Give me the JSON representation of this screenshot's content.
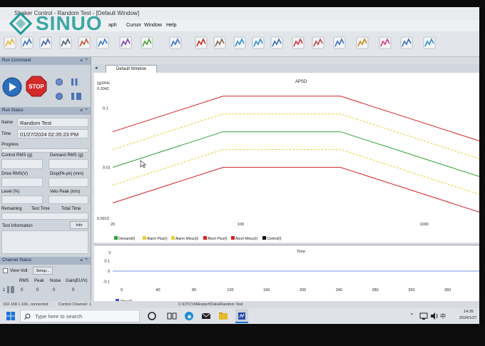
{
  "logo": {
    "text": "SINUO"
  },
  "window": {
    "title": "Shaker Control - Random Test - [Default Window]"
  },
  "menu": [
    {
      "label": "aph",
      "x": 152
    },
    {
      "label": "Cursor",
      "x": 177
    },
    {
      "label": "Window",
      "x": 202
    },
    {
      "label": "Help",
      "x": 233
    }
  ],
  "run_command": {
    "title": "Run Command",
    "stop_label": "STOP"
  },
  "run_status": {
    "title": "Run Status",
    "name_label": "Name",
    "name_value": "Random Test",
    "time_label": "Time",
    "time_value": "01/27/2024 02:35:23 PM",
    "progress_label": "Progress",
    "control_rms_label": "Control RMS (g)",
    "demand_rms_label": "Demand RMS (g)",
    "drive_rms_label": "Drive RMS(V)",
    "disp_label": "Disp(Pk-pk) (mm)",
    "level_label": "Level (%)",
    "velo_label": "Velo Peak (m/s)",
    "remaining_label": "Remaining",
    "test_time_label": "Test Time",
    "total_time_label": "Total Time",
    "test_info_label": "Test Information",
    "info_btn": "Info"
  },
  "channel_status": {
    "title": "Channel Status",
    "view_volt": "View Volt",
    "setup_btn": "Setup...",
    "columns": [
      "RMS",
      "Peak",
      "Noise",
      "Gain(EU/V)"
    ],
    "row": {
      "channel": "1",
      "values": [
        "0",
        "0",
        "0",
        "0"
      ]
    }
  },
  "tab": {
    "label": "Default Window"
  },
  "apsd": {
    "title": "APSD",
    "ylabel": "(g)2/Hz",
    "ymax_label": "0.2042",
    "ymin_label": "0.0013",
    "yticks": [
      "0.1",
      "0.01"
    ],
    "xticks": [
      "20",
      "100",
      "1000"
    ],
    "legend": [
      {
        "label": "Demand(l)",
        "color": "#2ea02e"
      },
      {
        "label": "Alarm Plus(l)",
        "color": "#e6cf2e"
      },
      {
        "label": "Alarm Minus(l)",
        "color": "#e6cf2e"
      },
      {
        "label": "Abort Plus(l)",
        "color": "#d62020"
      },
      {
        "label": "Abort Minus(l)",
        "color": "#d62020"
      },
      {
        "label": "Control(l)",
        "color": "#111111"
      }
    ]
  },
  "chart_data": {
    "type": "line",
    "title": "APSD",
    "xlabel": "",
    "ylabel": "(g)2/Hz",
    "xscale": "log",
    "yscale": "log",
    "xlim": [
      20,
      2000
    ],
    "ylim": [
      0.0013,
      0.2042
    ],
    "series": [
      {
        "name": "Demand(l)",
        "color": "#2ea02e",
        "dash": "solid",
        "x": [
          20,
          80,
          350,
          2000
        ],
        "y": [
          0.01,
          0.04,
          0.04,
          0.007
        ]
      },
      {
        "name": "Alarm Plus(l)",
        "color": "#e6cf2e",
        "dash": "dashed",
        "x": [
          20,
          80,
          350,
          2000
        ],
        "y": [
          0.02,
          0.08,
          0.08,
          0.014
        ]
      },
      {
        "name": "Alarm Minus(l)",
        "color": "#e6cf2e",
        "dash": "dashed",
        "x": [
          20,
          80,
          350,
          2000
        ],
        "y": [
          0.005,
          0.02,
          0.02,
          0.0035
        ]
      },
      {
        "name": "Abort Plus(l)",
        "color": "#d62020",
        "dash": "solid",
        "x": [
          20,
          80,
          350,
          2000
        ],
        "y": [
          0.04,
          0.16,
          0.16,
          0.028
        ]
      },
      {
        "name": "Abort Minus(l)",
        "color": "#d62020",
        "dash": "solid",
        "x": [
          20,
          80,
          350,
          2000
        ],
        "y": [
          0.0025,
          0.01,
          0.01,
          0.00175
        ]
      }
    ]
  },
  "time_plot": {
    "title": "Time",
    "ylabel": "V",
    "yticks": [
      "0.1",
      "0",
      "-0.1"
    ],
    "xticks": [
      "0",
      "40",
      "80",
      "120",
      "160",
      "200",
      "240",
      "280",
      "320",
      "360"
    ],
    "legend": "Drive(l)",
    "xlim": [
      -10,
      395
    ],
    "ylim": [
      -0.15,
      0.15
    ],
    "drive_level": 0
  },
  "status_bar": {
    "connection": "192.168.1.166, connected",
    "channel": "Control Channel: 1",
    "path": "C:\\DTC\\VibExpert\\Data\\Random Test"
  },
  "taskbar": {
    "search_placeholder": "Type here to search",
    "time": "14:35",
    "date": "2024/1/27",
    "lang": "中"
  }
}
